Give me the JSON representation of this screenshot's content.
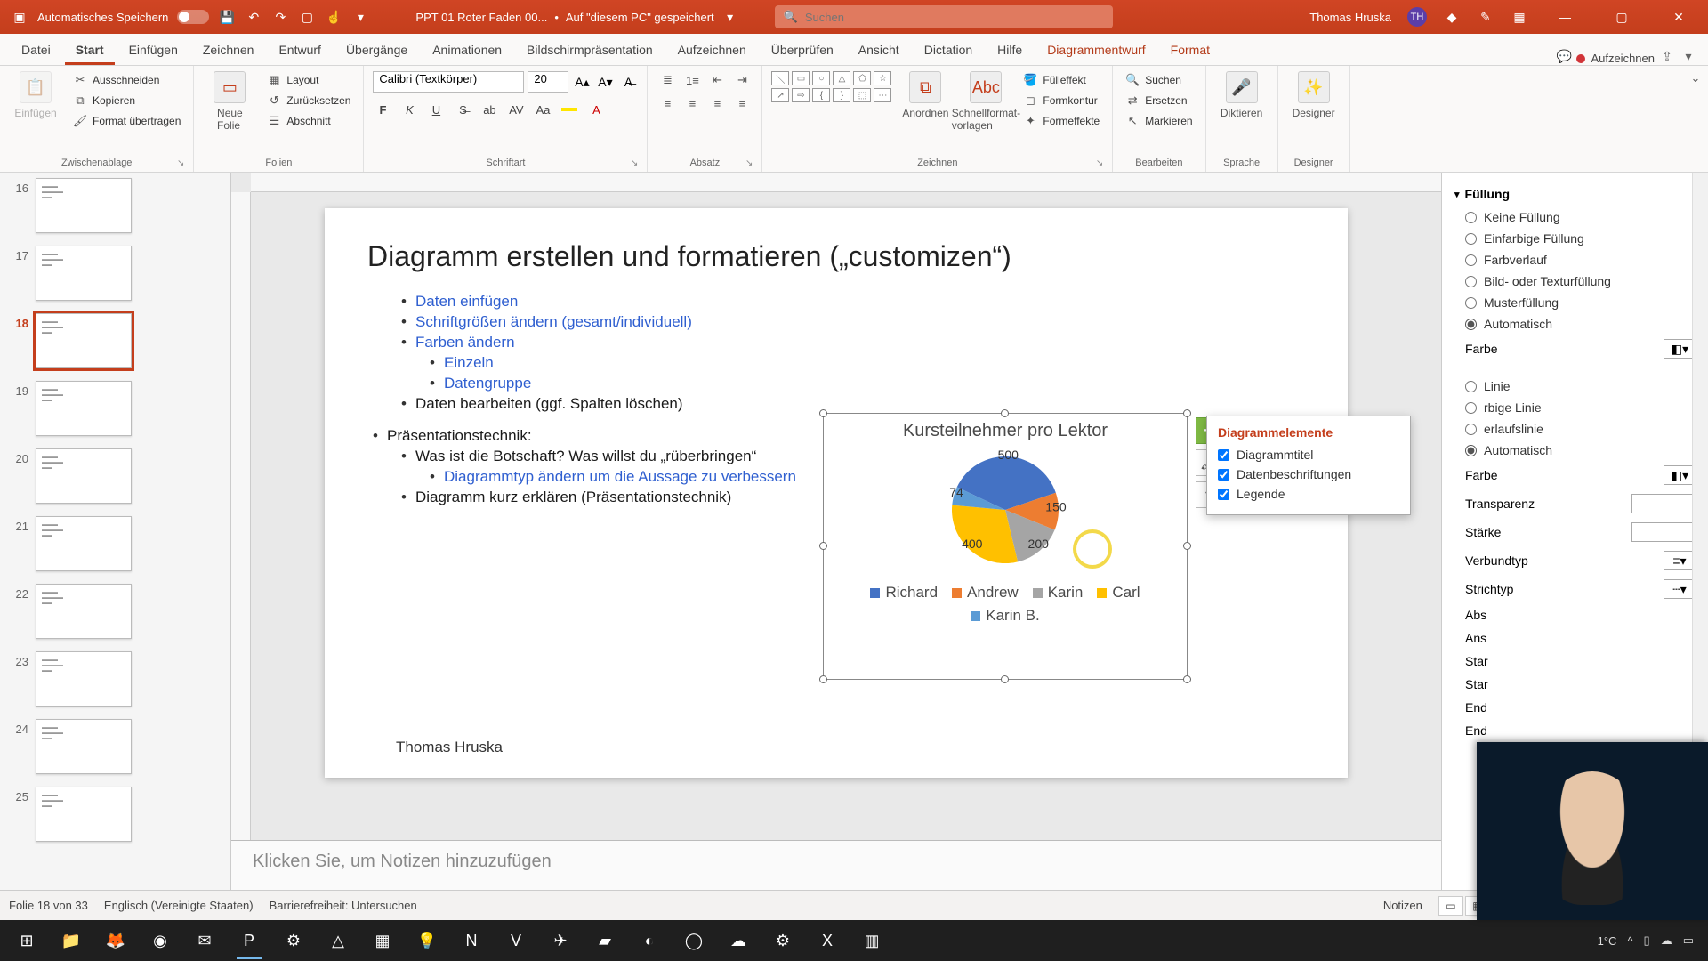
{
  "titlebar": {
    "autosave_label": "Automatisches Speichern",
    "doc_name": "PPT 01 Roter Faden 00...",
    "saved_hint": "Auf \"diesem PC\" gespeichert",
    "search_ph": "Suchen",
    "user_name": "Thomas Hruska",
    "user_initials": "TH"
  },
  "tabs": {
    "items": [
      "Datei",
      "Start",
      "Einfügen",
      "Zeichnen",
      "Entwurf",
      "Übergänge",
      "Animationen",
      "Bildschirmpräsentation",
      "Aufzeichnen",
      "Überprüfen",
      "Ansicht",
      "Dictation",
      "Hilfe",
      "Diagrammentwurf",
      "Format"
    ],
    "active_index": 1,
    "contextual_from": 13,
    "record_label": "Aufzeichnen"
  },
  "ribbon": {
    "clipboard": {
      "paste": "Einfügen",
      "cut": "Ausschneiden",
      "copy": "Kopieren",
      "fmt": "Format übertragen",
      "group": "Zwischenablage"
    },
    "slides": {
      "new": "Neue\nFolie",
      "layout": "Layout",
      "reset": "Zurücksetzen",
      "section": "Abschnitt",
      "group": "Folien"
    },
    "font": {
      "name": "Calibri (Textkörper)",
      "size": "20",
      "group": "Schriftart"
    },
    "para": {
      "group": "Absatz"
    },
    "draw": {
      "arrange": "Anordnen",
      "quick": "Schnellformat-\nvorlagen",
      "fill": "Fülleffekt",
      "outline": "Formkontur",
      "effects": "Formeffekte",
      "group": "Zeichnen"
    },
    "edit": {
      "find": "Suchen",
      "replace": "Ersetzen",
      "select": "Markieren",
      "group": "Bearbeiten"
    },
    "voice": {
      "dictate": "Diktieren",
      "group": "Sprache"
    },
    "designer": {
      "btn": "Designer",
      "group": "Designer"
    }
  },
  "thumbs": {
    "start": 16,
    "count": 10,
    "selected": 18
  },
  "slide": {
    "title": "Diagramm erstellen und formatieren („customizen“)",
    "b1": "Daten einfügen",
    "b2": "Schriftgrößen ändern (gesamt/individuell)",
    "b3": "Farben ändern",
    "b3a": "Einzeln",
    "b3b": "Datengruppe",
    "b4": "Daten bearbeiten (ggf. Spalten löschen)",
    "b5": "Präsentationstechnik:",
    "b5a": "Was ist die Botschaft? Was willst du „rüberbringen“",
    "b5b": "Diagrammtyp ändern um die Aussage zu verbessern",
    "b5c": "Diagramm kurz erklären (Präsentationstechnik)",
    "footer": "Thomas Hruska"
  },
  "chart_data": {
    "type": "pie",
    "title": "Kursteilnehmer pro Lektor",
    "series": [
      {
        "name": "Richard",
        "value": 500,
        "color": "#4472c4"
      },
      {
        "name": "Andrew",
        "value": 150,
        "color": "#ed7d31"
      },
      {
        "name": "Karin",
        "value": 200,
        "color": "#a5a5a5"
      },
      {
        "name": "Carl",
        "value": 400,
        "color": "#ffc000"
      },
      {
        "name": "Karin B.",
        "value": 74,
        "color": "#5b9bd5"
      }
    ],
    "legend_position": "bottom",
    "data_labels": true
  },
  "chart_flyout": {
    "title": "Diagrammelemente",
    "items": [
      {
        "label": "Diagrammtitel",
        "checked": true
      },
      {
        "label": "Datenbeschriftungen",
        "checked": true
      },
      {
        "label": "Legende",
        "checked": true
      }
    ]
  },
  "format_pane": {
    "fill_hdr": "Füllung",
    "fill_opts": [
      "Keine Füllung",
      "Einfarbige Füllung",
      "Farbverlauf",
      "Bild- oder Texturfüllung",
      "Musterfüllung",
      "Automatisch"
    ],
    "fill_selected": 5,
    "color_lbl": "Farbe",
    "line_opts_visible": [
      "Linie",
      "rbige Linie",
      "erlaufslinie",
      "Automatisch"
    ],
    "line_selected": 3,
    "transp_lbl": "Transparenz",
    "width_lbl": "Stärke",
    "compound_lbl": "Verbundtyp",
    "dash_lbl": "Strichtyp",
    "truncated": [
      "Abs",
      "Ans",
      "Star",
      "Star",
      "End",
      "End"
    ]
  },
  "notes_placeholder": "Klicken Sie, um Notizen hinzuzufügen",
  "status": {
    "slide": "Folie 18 von 33",
    "lang": "Englisch (Vereinigte Staaten)",
    "access": "Barrierefreiheit: Untersuchen",
    "notes_btn": "Notizen"
  },
  "taskbar": {
    "weather": "1°C",
    "time": ""
  }
}
